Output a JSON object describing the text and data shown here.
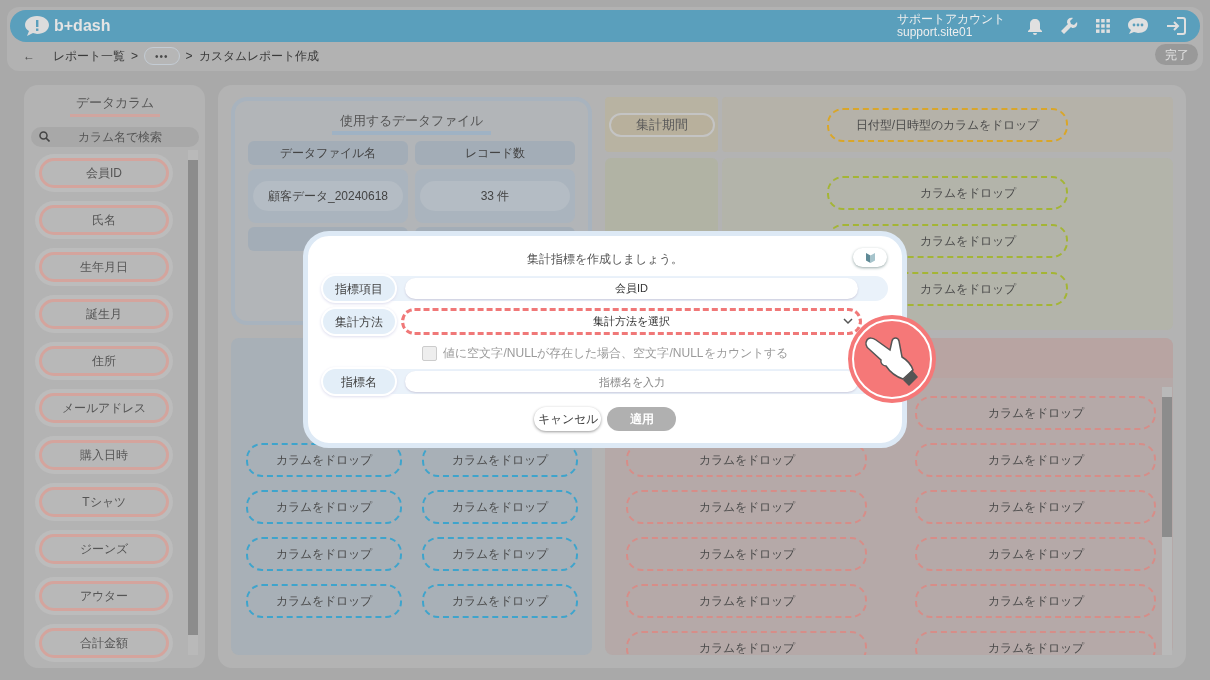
{
  "header": {
    "logo": "b+dash",
    "account_label": "サポートアカウント",
    "account_id": "support.site01"
  },
  "breadcrumb": [
    {
      "kind": "back",
      "label": "←"
    },
    {
      "kind": "link",
      "label": "レポート一覧"
    },
    {
      "kind": "sep",
      "label": ">"
    },
    {
      "kind": "more",
      "label": "•••"
    },
    {
      "kind": "sep",
      "label": ">"
    },
    {
      "kind": "current",
      "label": "カスタムレポート作成"
    }
  ],
  "done_button": {
    "label": "完了",
    "disabled": true
  },
  "columns_panel": {
    "title": "データカラム",
    "search_placeholder": "カラム名で検索",
    "items": [
      "会員ID",
      "氏名",
      "生年月日",
      "誕生月",
      "住所",
      "メールアドレス",
      "購入日時",
      "Tシャツ",
      "ジーンズ",
      "アウター",
      "合計金額"
    ]
  },
  "data_file": {
    "title": "使用するデータファイル",
    "columns": [
      "データファイル名",
      "レコード数"
    ],
    "rows": [
      [
        "顧客データ_20240618",
        "33 件"
      ]
    ]
  },
  "period": {
    "label": "集計期間",
    "drop_hint": "日付型/日時型のカラムをドロップ"
  },
  "group_zones": [
    "カラムをドロップ",
    "カラムをドロップ",
    "カラムをドロップ"
  ],
  "dimension_zones": [
    "カラムをドロップ",
    "カラムをドロップ",
    "カラムをドロップ",
    "カラムをドロップ",
    "カラムをドロップ",
    "カラムをドロップ",
    "カラムをドロップ",
    "カラムをドロップ"
  ],
  "metric_zones": [
    "カラムをドロップ",
    "カラムをドロップ",
    "カラムをドロップ",
    "カラムをドロップ",
    "カラムをドロップ",
    "カラムをドロップ",
    "カラムをドロップ",
    "カラムをドロップ",
    "カラムをドロップ",
    "カラムをドロップ",
    "カラムをドロップ"
  ],
  "modal": {
    "title": "集計指標を作成しましょう。",
    "fields": [
      {
        "kind": "value",
        "label": "指標項目",
        "value": "会員ID"
      },
      {
        "kind": "select",
        "label": "集計方法",
        "placeholder": "集計方法を選択",
        "highlighted": true
      },
      {
        "kind": "checkbox",
        "label": "値に空文字/NULLが存在した場合、空文字/NULLをカウントする",
        "checked": false,
        "disabled": true
      },
      {
        "kind": "input",
        "label": "指標名",
        "placeholder": "指標名を入力"
      }
    ],
    "buttons": [
      {
        "label": "キャンセル",
        "disabled": false
      },
      {
        "label": "適用",
        "disabled": true
      }
    ]
  }
}
